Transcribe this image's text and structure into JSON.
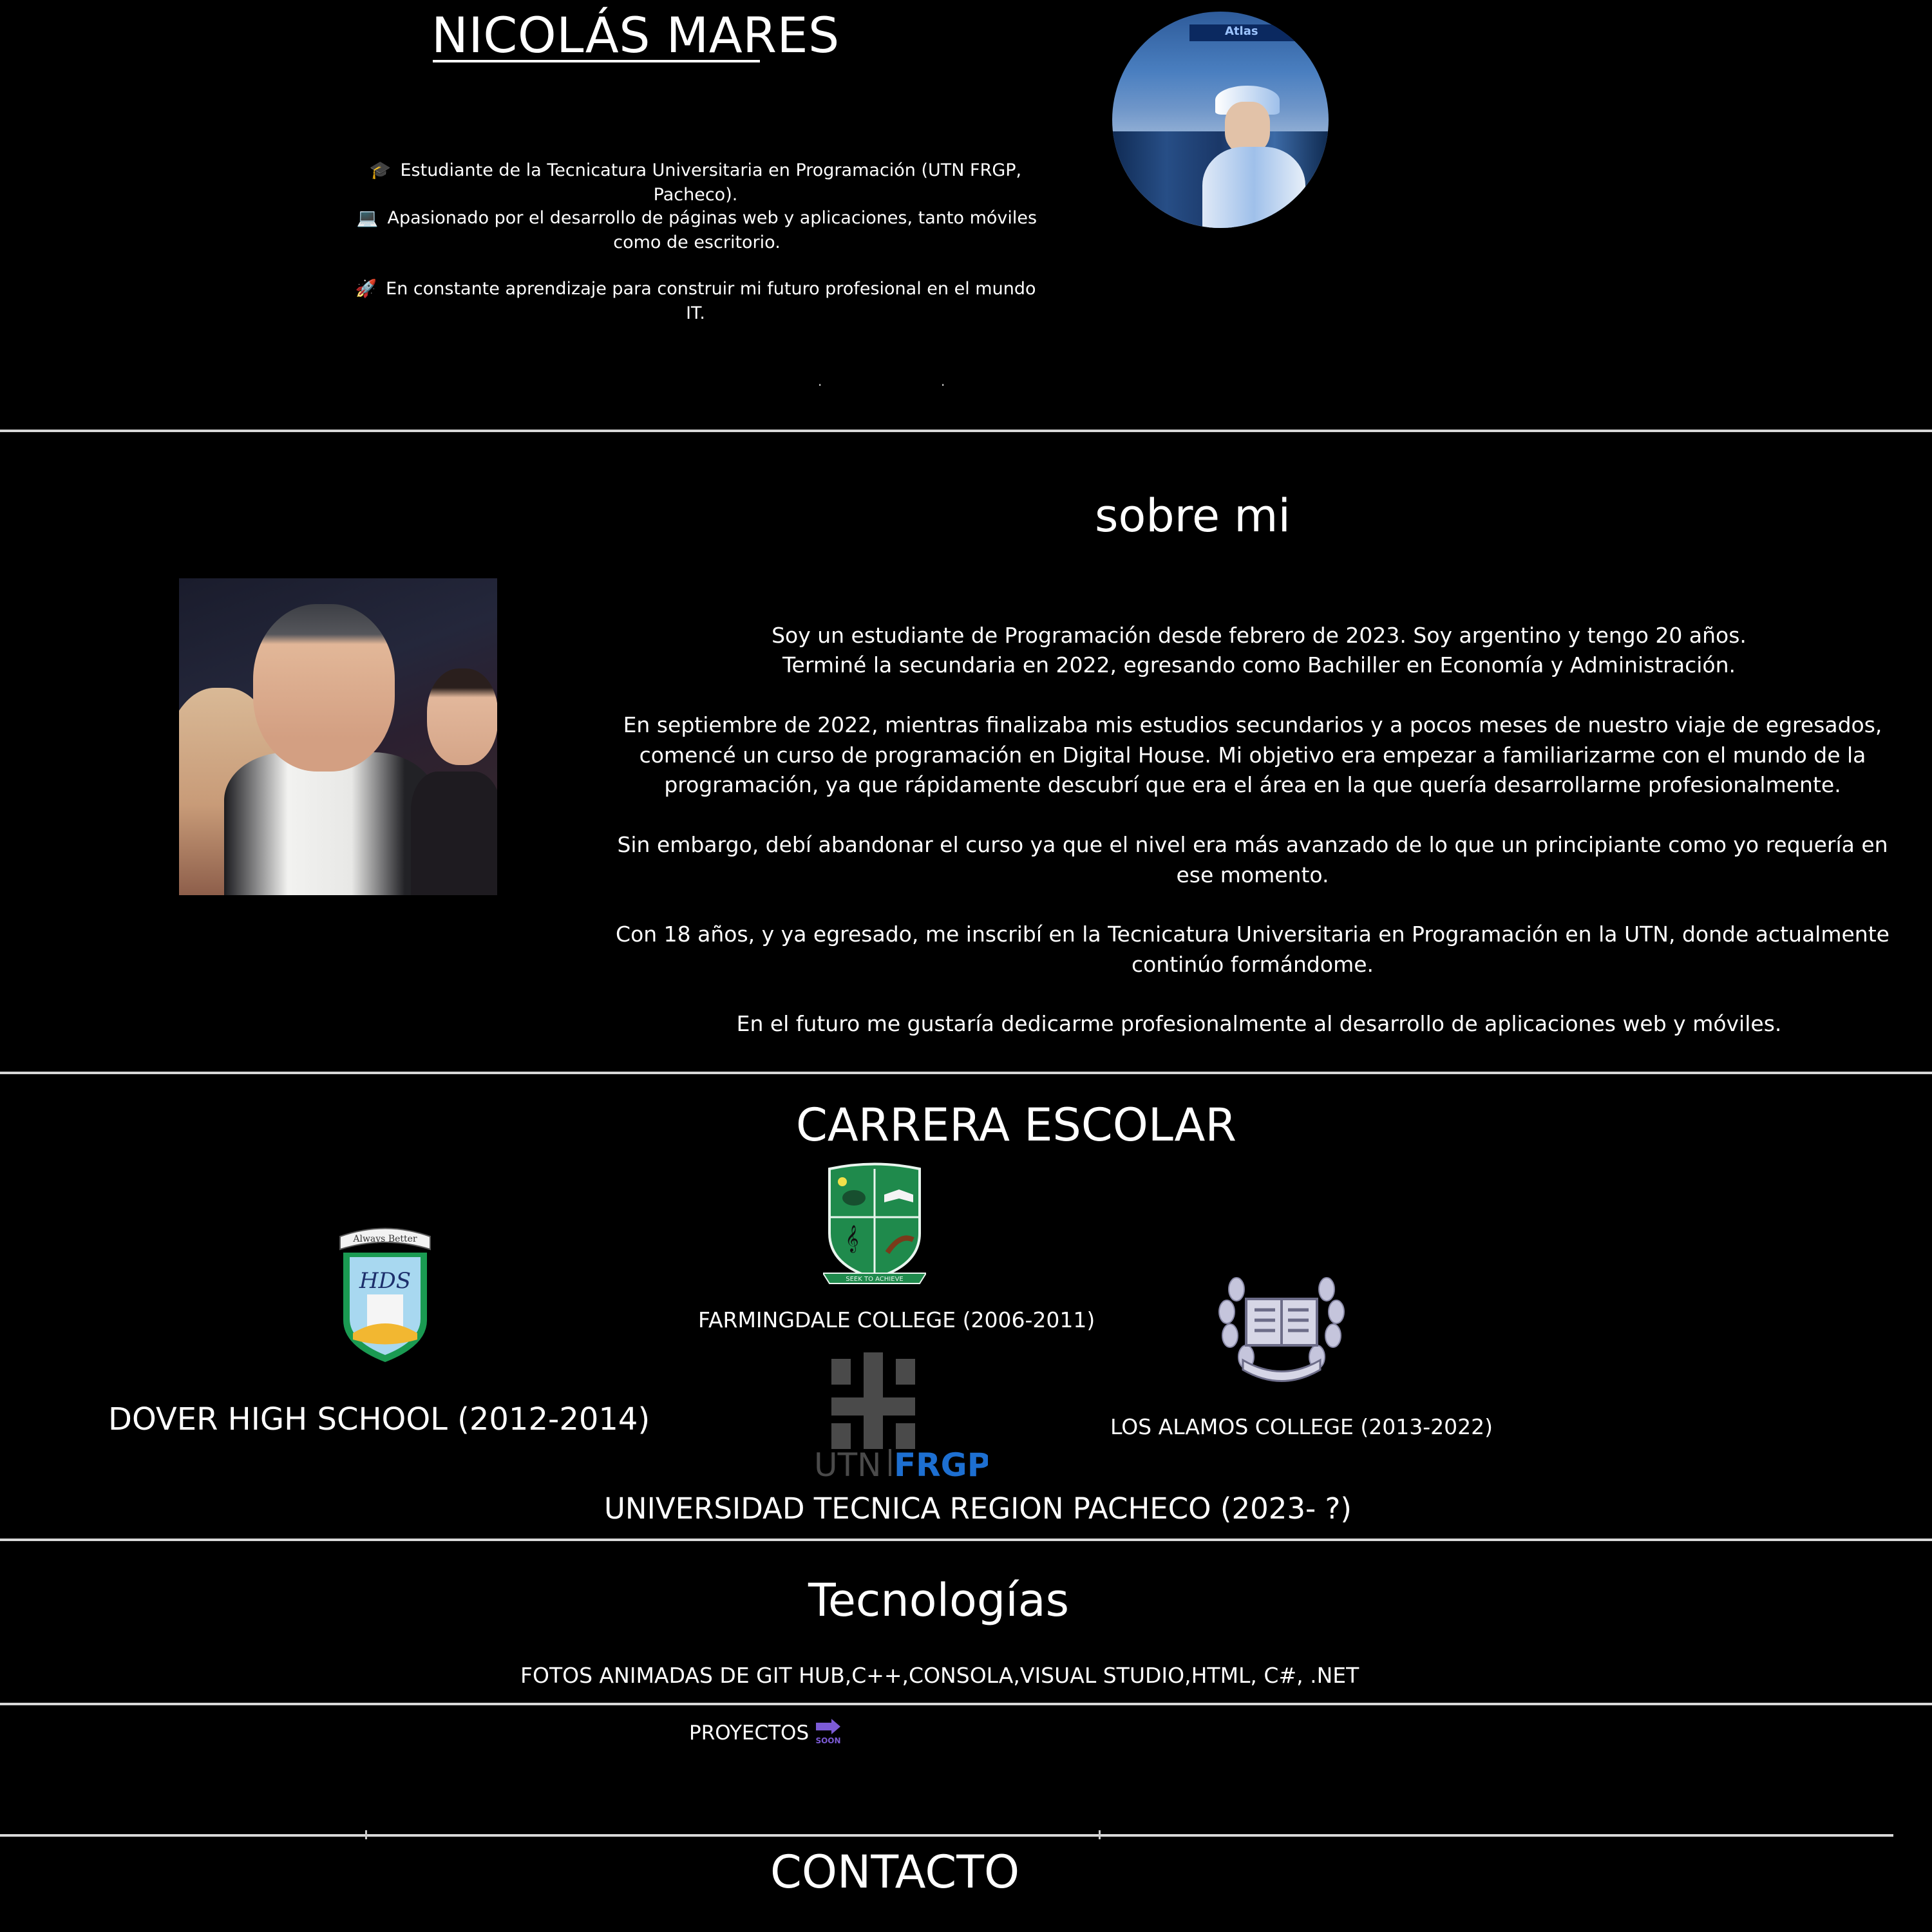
{
  "header": {
    "name": "NICOLÁS MARES",
    "bio": [
      {
        "icon": "graduation-cap-icon",
        "glyph": "🎓",
        "text": "Estudiante de la Tecnicatura Universitaria en Programación (UTN FRGP, Pacheco)."
      },
      {
        "icon": "laptop-icon",
        "glyph": "💻",
        "text": "Apasionado por el desarrollo de páginas web y aplicaciones, tanto móviles como de escritorio."
      },
      {
        "icon": "rocket-icon",
        "glyph": "🚀",
        "text": "En constante aprendizaje para construir mi futuro profesional en el mundo IT."
      }
    ],
    "avatar_banner_text": "Atlas",
    "dots": [
      ".",
      "."
    ]
  },
  "about": {
    "title": "sobre mi",
    "paragraphs": [
      "Soy un estudiante de Programación desde febrero de 2023. Soy argentino y tengo 20 años.",
      "Terminé la secundaria en 2022, egresando como Bachiller en Economía y Administración.",
      "En septiembre de 2022, mientras finalizaba mis estudios secundarios y a pocos meses de nuestro viaje de egresados, comencé un curso de programación en Digital House. Mi objetivo era empezar a familiarizarme con el mundo de la programación, ya que rápidamente descubrí que era el área en la que quería desarrollarme profesionalmente.",
      "Sin embargo, debí abandonar el curso ya que el nivel era más avanzado de lo que un principiante como yo requería en ese momento.",
      "Con 18 años, y ya egresado, me inscribí en la Tecnicatura Universitaria en Programación en la UTN, donde actualmente continúo formándome.",
      "En el futuro me gustaría dedicarme profesionalmente al desarrollo de aplicaciones web y móviles."
    ]
  },
  "career": {
    "title": "CARRERA ESCOLAR",
    "schools": {
      "dover": {
        "label": "DOVER HIGH SCHOOL (2012-2014)",
        "logo_top_text": "Always Better",
        "logo_text": "HDS"
      },
      "farmingdale": {
        "label": "FARMINGDALE COLLEGE (2006-2011)",
        "logo_ribbon_text": "SEEK TO ACHIEVE"
      },
      "alamos": {
        "label": "LOS ALAMOS COLLEGE (2013-2022)"
      },
      "utn": {
        "label": "UNIVERSIDAD TECNICA REGION PACHECO (2023- ?)",
        "logo_utn": "UTN",
        "logo_frgp": "FRGP"
      }
    }
  },
  "tech": {
    "title": "Tecnologías",
    "list": "FOTOS ANIMADAS DE GIT HUB,C++,CONSOLA,VISUAL STUDIO,HTML, C#, .NET"
  },
  "projects": {
    "label": "PROYECTOS",
    "soon_badge": "SOON"
  },
  "contact": {
    "title": "CONTACTO"
  },
  "colors": {
    "background": "#000000",
    "text": "#ffffff",
    "divider": "#d8d8d8",
    "utn_blue": "#1d6fd1",
    "soon_purple": "#7c5bd6",
    "farmingdale_green": "#1f8a4c",
    "dover_green": "#1a9a52"
  }
}
